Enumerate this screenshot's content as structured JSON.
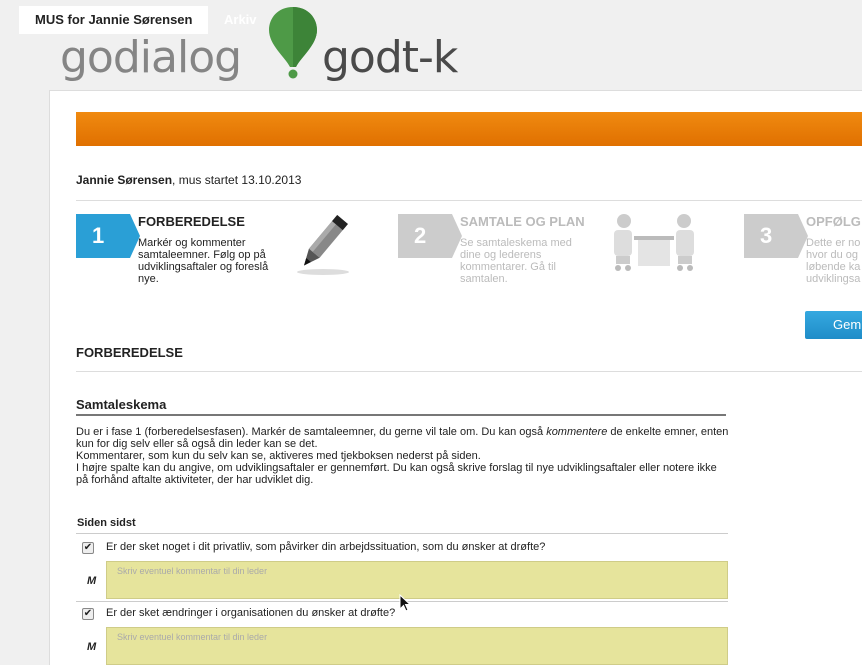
{
  "logo": {
    "left_text": "godialog",
    "right_text": "godt-k"
  },
  "tabs": [
    {
      "label": "MUS for Jannie Sørensen"
    },
    {
      "label": "Arkiv"
    }
  ],
  "person": {
    "name": "Jannie Sørensen",
    "status": ", mus startet 13.10.2013"
  },
  "steps": [
    {
      "number": "1",
      "title": "FORBEREDELSE",
      "desc": [
        "Markér og kommenter",
        "samtaleemner. Følg op på",
        "udviklingsaftaler og foreslå",
        "nye."
      ]
    },
    {
      "number": "2",
      "title": "SAMTALE OG PLAN",
      "desc": [
        "Se samtaleskema med",
        "dine og lederens",
        "kommentarer. Gå til",
        "samtalen."
      ]
    },
    {
      "number": "3",
      "title": "OPFØLG",
      "desc": [
        "Dette er no",
        "hvor du og",
        "løbende ka",
        "udviklingsa"
      ]
    }
  ],
  "save_button": "Gem",
  "section_heading": "FORBEREDELSE",
  "form": {
    "title": "Samtaleskema",
    "intro": [
      [
        "Du er i fase 1 (forberedelsesfasen). Markér de samtaleemner, du gerne vil tale om. Du kan også ",
        "kommentere",
        " de enkelte emner, enten"
      ],
      [
        "kun for dig selv eller så også din leder kan se det.",
        "",
        ""
      ],
      [
        "Kommentarer, som kun du selv kan se, aktiveres med tjekboksen nederst på siden.",
        "",
        ""
      ],
      [
        "I højre spalte kan du angive, om udviklingsaftaler er gennemført. Du kan også skrive forslag til nye udviklingsaftaler eller notere ikke",
        "",
        ""
      ],
      [
        "på forhånd aftalte aktiviteter, der har udviklet dig.",
        "",
        ""
      ]
    ],
    "subsection": "Siden sidst",
    "questions": [
      {
        "checked": true,
        "text": "Er der sket noget i dit privatliv, som påvirker din arbejdssituation, som du ønsker at drøfte?",
        "marker": "M",
        "placeholder": "Skriv eventuel kommentar til din leder"
      },
      {
        "checked": true,
        "text": "Er der sket ændringer i organisationen du ønsker at drøfte?",
        "marker": "M",
        "placeholder": "Skriv eventuel kommentar til din leder"
      }
    ]
  },
  "colors": {
    "tab_orange": "#e97d08",
    "step_active": "#2a9fd6",
    "step_inactive": "#cccccc",
    "comment_bg": "#e6e49c",
    "save_blue": "#2a9fd6"
  }
}
